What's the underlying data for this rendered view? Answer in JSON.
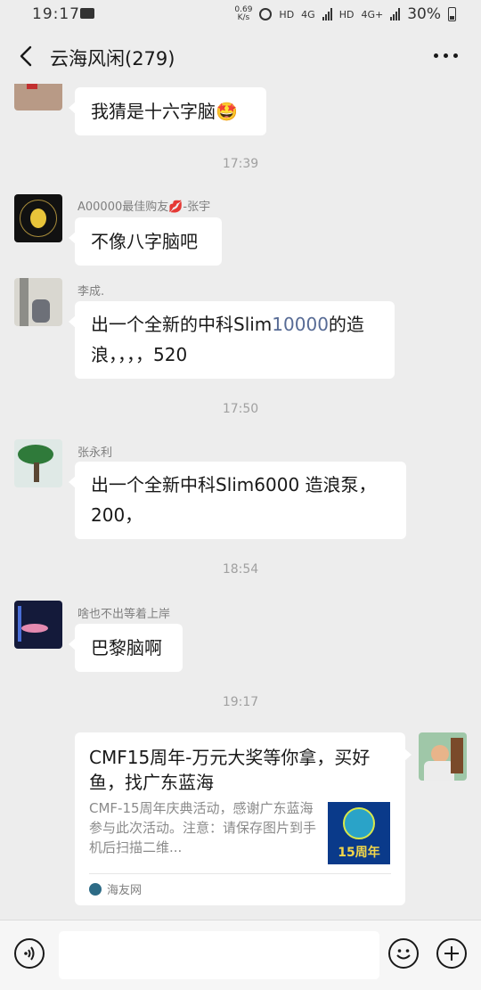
{
  "status_bar": {
    "time": "19:17",
    "net_speed": "0.69 K/s",
    "hd1": "HD",
    "net1": "4G",
    "hd2": "HD",
    "net2": "4G+",
    "battery": "30%"
  },
  "header": {
    "title": "云海风闲(279)"
  },
  "messages": [
    {
      "text": "我猜是十六字脑🤩"
    },
    {
      "timestamp": "17:39"
    },
    {
      "sender": "A00000最佳购友💋-张宇",
      "text": "不像八字脑吧"
    },
    {
      "sender": "李成.",
      "text_pre": "出一个全新的中科Slim",
      "text_hl": "10000",
      "text_post": "的造浪，，，，520"
    },
    {
      "timestamp": "17:50"
    },
    {
      "sender": "张永利",
      "text": "出一个全新中科Slim6000 造浪泵，200，"
    },
    {
      "timestamp": "18:54"
    },
    {
      "sender": "啥也不出等着上岸",
      "text": "巴黎脑啊"
    },
    {
      "timestamp": "19:17"
    }
  ],
  "link_card": {
    "title": "CMF15周年-万元大奖等你拿，买好鱼，找广东蓝海",
    "description": "CMF-15周年庆典活动，感谢广东蓝海参与此次活动。注意：请保存图片到手机后扫描二维...",
    "thumb_text": "15周年",
    "source": "海友网"
  },
  "colors": {
    "background": "#ededed",
    "bubble": "#ffffff",
    "link_text": "#576b95"
  }
}
